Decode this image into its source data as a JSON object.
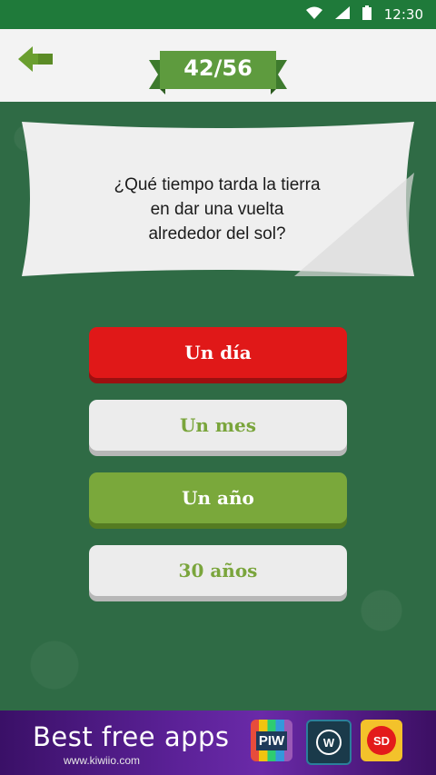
{
  "status_bar": {
    "time": "12:30",
    "icons": [
      "wifi-icon",
      "signal-icon",
      "battery-icon"
    ]
  },
  "header": {
    "back_icon": "back-arrow-icon",
    "counter": "42/56"
  },
  "question": {
    "line1": "¿Qué tiempo tarda la tierra",
    "line2": "en dar una vuelta",
    "line3": "alrededor del sol?"
  },
  "answers": [
    {
      "label": "Un día",
      "state": "wrong"
    },
    {
      "label": "Un mes",
      "state": "neutral"
    },
    {
      "label": "Un año",
      "state": "correct"
    },
    {
      "label": "30 años",
      "state": "neutral"
    }
  ],
  "ad": {
    "title": "Best free apps",
    "subtitle": "www.kiwiio.com",
    "apps": [
      {
        "label": "PIW",
        "icon": "piw-app-icon"
      },
      {
        "label": "W",
        "icon": "w-app-icon"
      },
      {
        "label": "SD",
        "icon": "sd-app-icon"
      }
    ]
  },
  "colors": {
    "status_bar": "#1f7a3a",
    "background": "#2f6b45",
    "header_green": "#4f8f3b",
    "wrong": "#e01818",
    "correct": "#7aa83b",
    "neutral": "#ececec"
  }
}
